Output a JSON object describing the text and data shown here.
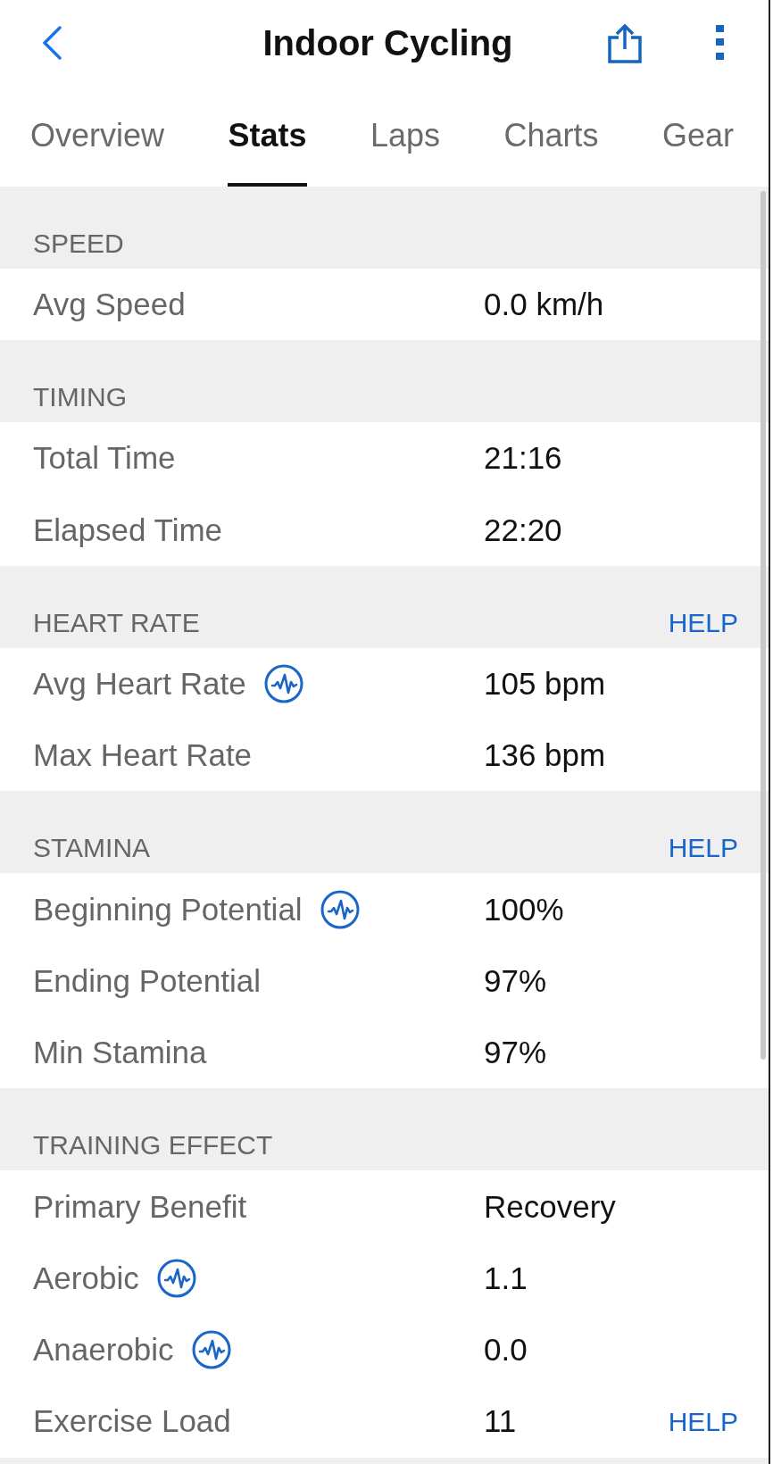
{
  "header": {
    "title": "Indoor Cycling"
  },
  "tabs": [
    {
      "label": "Overview",
      "selected": false
    },
    {
      "label": "Stats",
      "selected": true
    },
    {
      "label": "Laps",
      "selected": false
    },
    {
      "label": "Charts",
      "selected": false
    },
    {
      "label": "Gear",
      "selected": false
    }
  ],
  "sections": [
    {
      "title": "SPEED",
      "rows": [
        {
          "label": "Avg Speed",
          "value": "0.0 km/h",
          "pulse_icon": false
        }
      ]
    },
    {
      "title": "TIMING",
      "rows": [
        {
          "label": "Total Time",
          "value": "21:16",
          "pulse_icon": false
        },
        {
          "label": "Elapsed Time",
          "value": "22:20",
          "pulse_icon": false
        }
      ]
    },
    {
      "title": "HEART RATE",
      "help": "HELP",
      "rows": [
        {
          "label": "Avg Heart Rate",
          "value": "105 bpm",
          "pulse_icon": true
        },
        {
          "label": "Max Heart Rate",
          "value": "136 bpm",
          "pulse_icon": false
        }
      ]
    },
    {
      "title": "STAMINA",
      "help": "HELP",
      "rows": [
        {
          "label": "Beginning Potential",
          "value": "100%",
          "pulse_icon": true
        },
        {
          "label": "Ending Potential",
          "value": "97%",
          "pulse_icon": false
        },
        {
          "label": "Min Stamina",
          "value": "97%",
          "pulse_icon": false
        }
      ]
    },
    {
      "title": "TRAINING EFFECT",
      "rows": [
        {
          "label": "Primary Benefit",
          "value": "Recovery",
          "pulse_icon": false
        },
        {
          "label": "Aerobic",
          "value": "1.1",
          "pulse_icon": true
        },
        {
          "label": "Anaerobic",
          "value": "0.0",
          "pulse_icon": true
        },
        {
          "label": "Exercise Load",
          "value": "11",
          "pulse_icon": false,
          "help": "HELP"
        }
      ]
    }
  ]
}
